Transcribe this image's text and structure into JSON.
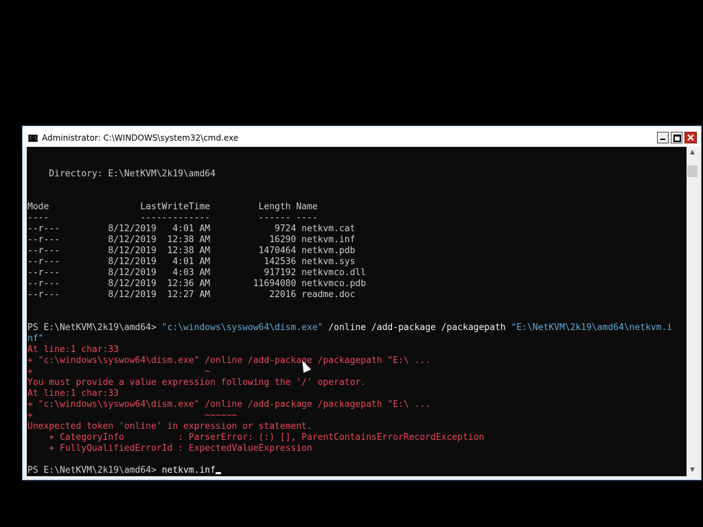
{
  "window": {
    "title": "Administrator: C:\\WINDOWS\\system32\\cmd.exe",
    "icon": "cmd-icon"
  },
  "console": {
    "directory_line": "    Directory: E:\\NetKVM\\2k19\\amd64",
    "header": "Mode                 LastWriteTime         Length Name",
    "separator": "----                 -------------         ------ ----",
    "files": [
      {
        "mode": "--r---",
        "date": "8/12/2019",
        "time": "4:01 AM",
        "length": "9724",
        "name": "netkvm.cat"
      },
      {
        "mode": "--r---",
        "date": "8/12/2019",
        "time": "12:38 AM",
        "length": "16290",
        "name": "netkvm.inf"
      },
      {
        "mode": "--r---",
        "date": "8/12/2019",
        "time": "12:38 AM",
        "length": "1470464",
        "name": "netkvm.pdb"
      },
      {
        "mode": "--r---",
        "date": "8/12/2019",
        "time": "4:01 AM",
        "length": "142536",
        "name": "netkvm.sys"
      },
      {
        "mode": "--r---",
        "date": "8/12/2019",
        "time": "4:03 AM",
        "length": "917192",
        "name": "netkvmco.dll"
      },
      {
        "mode": "--r---",
        "date": "8/12/2019",
        "time": "12:36 AM",
        "length": "11694080",
        "name": "netkvmco.pdb"
      },
      {
        "mode": "--r---",
        "date": "8/12/2019",
        "time": "12:27 AM",
        "length": "22016",
        "name": "readme.doc"
      }
    ],
    "prompt": "PS E:\\NetKVM\\2k19\\amd64> ",
    "command": {
      "exe": "\"c:\\windows\\syswow64\\dism.exe\"",
      "args": " /online /add-package /packagepath ",
      "path_part1": "\"E:\\NetKVM\\2k19\\amd64\\netkvm.i",
      "path_part2": "nf\""
    },
    "errors": [
      "At line:1 char:33",
      "+ \"c:\\windows\\syswow64\\dism.exe\" /online /add-package /packagepath \"E:\\ ...",
      "+                                ~",
      "You must provide a value expression following the '/' operator.",
      "At line:1 char:33",
      "+ \"c:\\windows\\syswow64\\dism.exe\" /online /add-package /packagepath \"E:\\ ...",
      "+                                ~~~~~~",
      "Unexpected token 'online' in expression or statement.",
      "    + CategoryInfo          : ParserError: (:) [], ParentContainsErrorRecordException",
      "    + FullyQualifiedErrorId : ExpectedValueExpression"
    ],
    "current_input": "netkvm.inf"
  },
  "colors": {
    "console_bg": "#0c0c0c",
    "text": "#cccccc",
    "error": "#e74856",
    "string": "#61a8d8"
  }
}
